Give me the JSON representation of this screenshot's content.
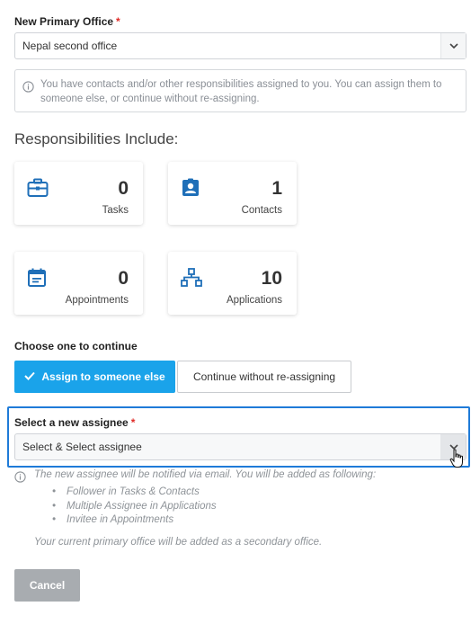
{
  "primary_office": {
    "label": "New Primary Office",
    "required_mark": "*",
    "value": "Nepal second office"
  },
  "info_message": "You have contacts and/or other responsibilities assigned to you. You can assign them to someone else, or continue without re-assigning.",
  "responsibilities": {
    "title": "Responsibilities Include:",
    "cards": [
      {
        "icon": "briefcase-icon",
        "count": "0",
        "label": "Tasks"
      },
      {
        "icon": "contact-badge-icon",
        "count": "1",
        "label": "Contacts"
      },
      {
        "icon": "calendar-icon",
        "count": "0",
        "label": "Appointments"
      },
      {
        "icon": "sitemap-icon",
        "count": "10",
        "label": "Applications"
      }
    ]
  },
  "choice": {
    "heading": "Choose one to continue",
    "assign_label": "Assign to someone else",
    "continue_label": "Continue without re-assigning"
  },
  "assignee": {
    "label": "Select a new assignee",
    "required_mark": "*",
    "value": "Select & Select assignee"
  },
  "notes": {
    "intro": "The new assignee will be notified via email. You will be added as following:",
    "items": [
      "Follower in Tasks & Contacts",
      "Multiple Assignee in Applications",
      "Invitee in Appointments"
    ],
    "footer": "Your current primary office will be added as a secondary office."
  },
  "cancel_label": "Cancel",
  "colors": {
    "accent": "#1aa3ea",
    "icon_blue": "#1f6fb8",
    "focus_border": "#1f7bd8",
    "required": "#e02b27",
    "cancel_bg": "#a8acb0"
  }
}
